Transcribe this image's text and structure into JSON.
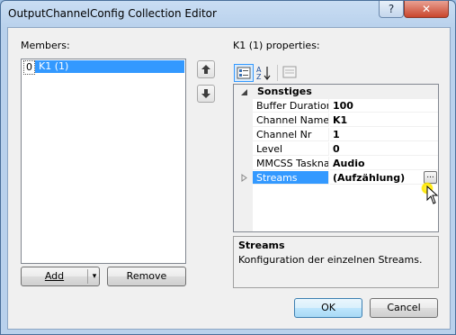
{
  "window": {
    "title": "OutputChannelConfig Collection Editor",
    "help_label": "?",
    "close_label": "✕"
  },
  "members": {
    "label": "Members:",
    "items": [
      {
        "index": "0",
        "name": "K1 (1)"
      }
    ],
    "move_up_icon": "arrow-up-icon",
    "move_down_icon": "arrow-down-icon"
  },
  "properties": {
    "label": "K1 (1) properties:",
    "category": "Sonstiges",
    "rows": [
      {
        "name": "Buffer Duration",
        "value": "100"
      },
      {
        "name": "Channel Name",
        "value": "K1"
      },
      {
        "name": "Channel Nr",
        "value": "1"
      },
      {
        "name": "Level",
        "value": "0"
      },
      {
        "name": "MMCSS Tasknar",
        "value": "Audio"
      },
      {
        "name": "Streams",
        "value": "(Aufzählung)"
      }
    ],
    "ellipsis_label": "...",
    "description": {
      "title": "Streams",
      "text": "Konfiguration der einzelnen Streams."
    }
  },
  "buttons": {
    "add": "Add",
    "add_dropdown": "▾",
    "remove": "Remove",
    "ok": "OK",
    "cancel": "Cancel"
  },
  "colors": {
    "selection": "#3399ff",
    "title_bg": "#c9ddf3"
  }
}
